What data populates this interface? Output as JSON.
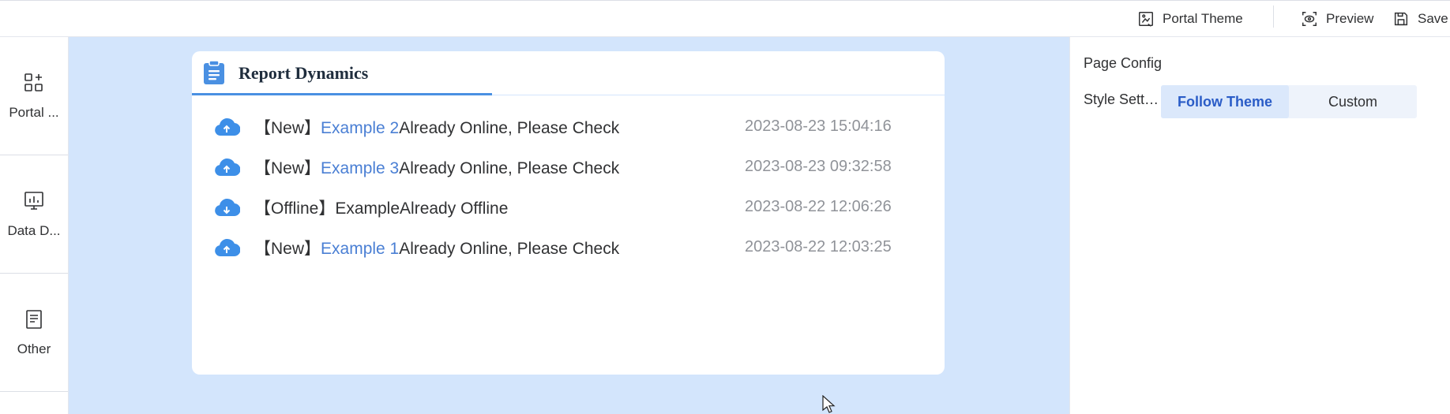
{
  "topbar": {
    "portal_theme_label": "Portal Theme",
    "preview_label": "Preview",
    "save_label": "Save"
  },
  "leftnav": {
    "items": [
      {
        "label": "Portal ...",
        "icon": "widgets-add-icon"
      },
      {
        "label": "Data D...",
        "icon": "bar-chart-monitor-icon"
      },
      {
        "label": "Other",
        "icon": "document-icon"
      }
    ]
  },
  "card": {
    "title": "Report Dynamics",
    "rows": [
      {
        "icon": "cloud-upload-icon",
        "tag": "【New】",
        "link": "Example 2",
        "rest": "Already Online, Please Check",
        "time": "2023-08-23 15:04:16"
      },
      {
        "icon": "cloud-upload-icon",
        "tag": "【New】",
        "link": "Example 3",
        "rest": "Already Online, Please Check",
        "time": "2023-08-23 09:32:58"
      },
      {
        "icon": "cloud-download-icon",
        "tag": "【Offline】",
        "link": "",
        "rest": "ExampleAlready Offline",
        "time": "2023-08-22 12:06:26"
      },
      {
        "icon": "cloud-upload-icon",
        "tag": "【New】",
        "link": "Example 1",
        "rest": "Already Online, Please Check",
        "time": "2023-08-22 12:03:25"
      }
    ]
  },
  "rightpanel": {
    "title": "Page Config",
    "style_label": "Style Setti...",
    "options": [
      "Follow Theme",
      "Custom"
    ],
    "selected": "Follow Theme"
  },
  "colors": {
    "accent": "#4a90e2",
    "canvas_bg": "#d3e5fc",
    "link": "#4a7fd4"
  }
}
